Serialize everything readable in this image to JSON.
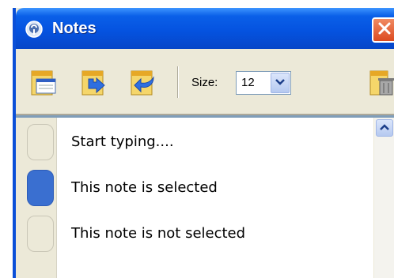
{
  "window": {
    "title": "Notes",
    "accent_color": "#0553e0",
    "close_color": "#dc4a20"
  },
  "toolbar": {
    "buttons": [
      {
        "icon": "new-note-icon"
      },
      {
        "icon": "import-note-icon"
      },
      {
        "icon": "export-note-icon"
      },
      {
        "icon": "trash-icon"
      }
    ],
    "size_label": "Size:",
    "size_value": "12"
  },
  "notes": [
    {
      "text": "Start typing....",
      "selected": false
    },
    {
      "text": "This note is selected",
      "selected": true
    },
    {
      "text": "This note is not selected",
      "selected": false
    }
  ],
  "colors": {
    "selected_marker": "#3a6fd0"
  }
}
